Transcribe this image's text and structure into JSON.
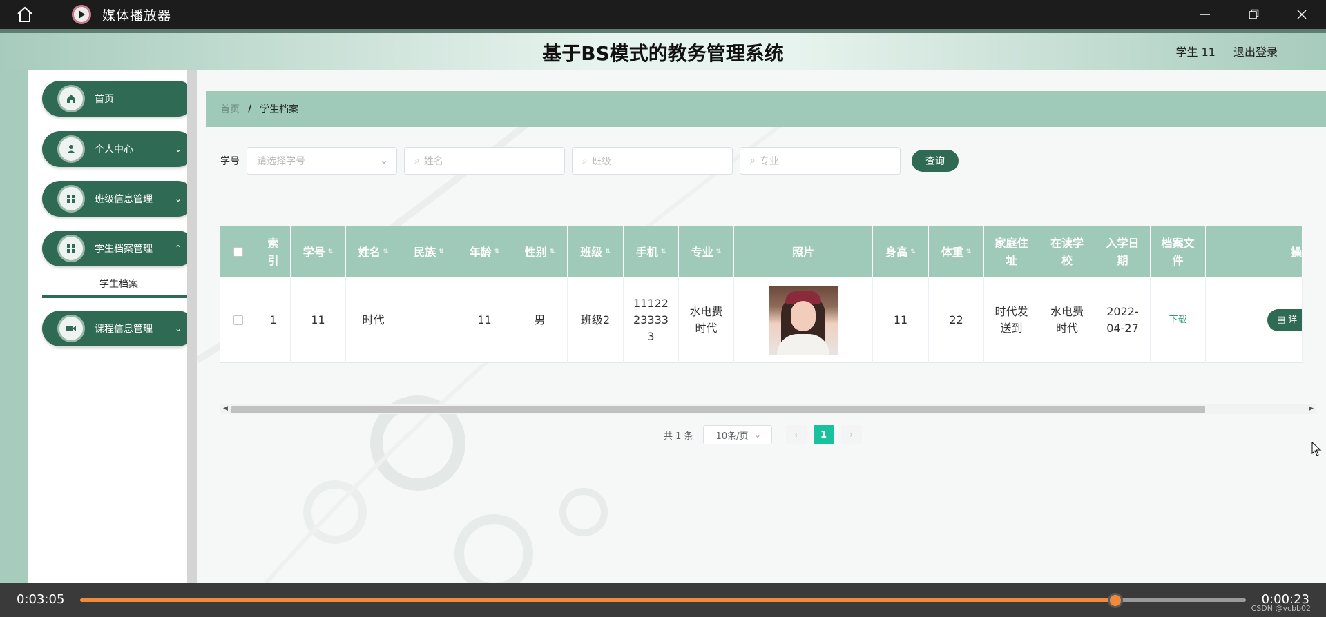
{
  "player": {
    "title": "媒体播放器",
    "elapsed": "0:03:05",
    "remaining": "0:00:23",
    "progress": 0.888,
    "watermark": "CSDN @vcbb02"
  },
  "header": {
    "title": "基于BS模式的教务管理系统",
    "user": "学生 11",
    "logout": "退出登录"
  },
  "sidebar": {
    "items": [
      {
        "label": "首页"
      },
      {
        "label": "个人中心"
      },
      {
        "label": "班级信息管理"
      },
      {
        "label": "学生档案管理"
      },
      {
        "label": "课程信息管理"
      }
    ],
    "submenu": "学生档案"
  },
  "breadcrumb": {
    "home": "首页",
    "sep": "/",
    "current": "学生档案"
  },
  "search": {
    "label": "学号",
    "xuehao_placeholder": "请选择学号",
    "name_placeholder": "姓名",
    "class_placeholder": "班级",
    "major_placeholder": "专业",
    "query": "查询"
  },
  "table": {
    "columns": [
      "索引",
      "学号",
      "姓名",
      "民族",
      "年龄",
      "性别",
      "班级",
      "手机",
      "专业",
      "照片",
      "身高",
      "体重",
      "家庭住址",
      "在读学校",
      "入学日期",
      "档案文件",
      "操"
    ],
    "row": {
      "index": "1",
      "xuehao": "11",
      "name": "时代",
      "ethnic": "",
      "age": "11",
      "gender": "男",
      "class": "班级2",
      "phone": "11122233333",
      "major": "水电费时代",
      "height": "11",
      "weight": "22",
      "address": "时代发送到",
      "school": "水电费时代",
      "enroll": "2022-04-27",
      "file": "下载",
      "op": "详"
    }
  },
  "pager": {
    "total": "共 1 条",
    "size": "10条/页",
    "page": "1"
  },
  "colors": {
    "accent": "#2f6a54",
    "header_bg": "#9fc9b9",
    "progress": "#f28a3c",
    "page_active": "#19c29c"
  }
}
